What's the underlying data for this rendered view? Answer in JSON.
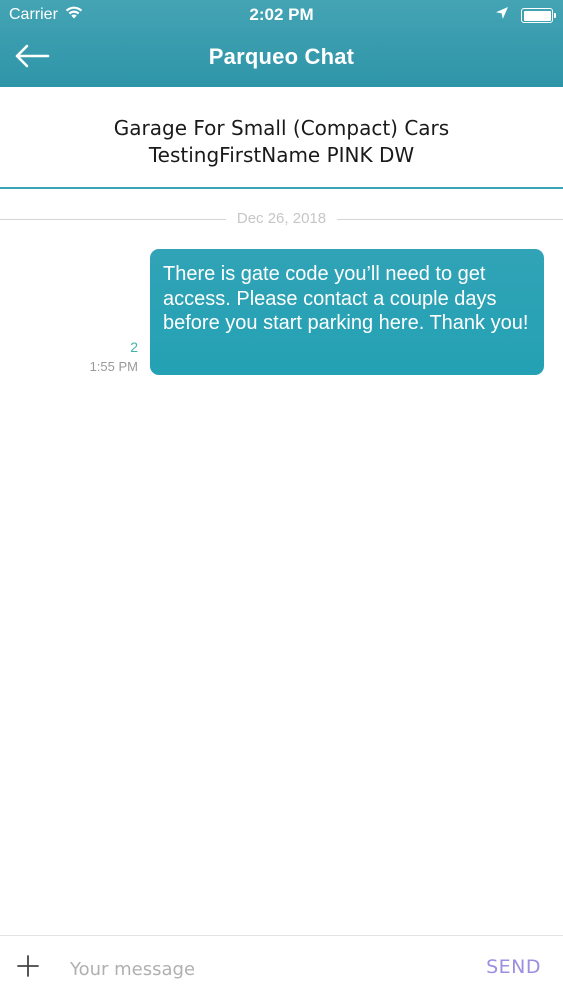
{
  "status_bar": {
    "carrier": "Carrier",
    "time": "2:02 PM",
    "battery_level": 1.0
  },
  "nav": {
    "title": "Parqueo Chat",
    "back_icon": "arrow-left-icon"
  },
  "conversation": {
    "listing_title": "Garage For Small (Compact) Cars",
    "participant": "TestingFirstName PINK DW"
  },
  "messages_group": {
    "date": "Dec 26, 2018",
    "messages": [
      {
        "text": "There is gate code you’ll need to get access. Please contact a couple days before you start parking here. Thank you!",
        "count": "2",
        "time": "1:55 PM"
      }
    ]
  },
  "composer": {
    "placeholder": "Your message",
    "send_label": "SEND",
    "add_icon": "plus-icon"
  },
  "colors": {
    "header": "#3a9db0",
    "bubble": "#2aa2b5",
    "send": "#9b8fe0",
    "count": "#3fb3a8"
  }
}
